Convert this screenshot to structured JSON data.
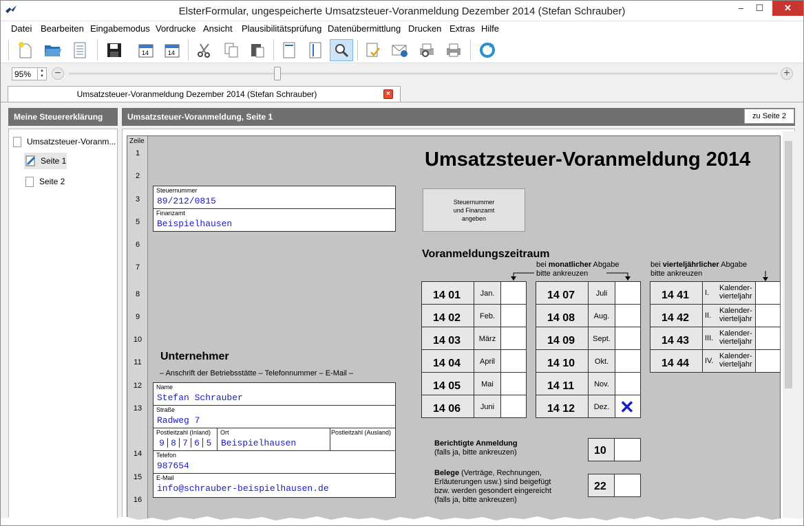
{
  "window": {
    "title": "ElsterFormular, ungespeicherte Umsatzsteuer-Voranmeldung Dezember 2014 (Stefan Schrauber)"
  },
  "menu": [
    "Datei",
    "Bearbeiten",
    "Eingabemodus",
    "Vordrucke",
    "Ansicht",
    "Plausibilitätsprüfung",
    "Datenübermittlung",
    "Drucken",
    "Extras",
    "Hilfe"
  ],
  "toolbar": {
    "icons": [
      "new-document-icon",
      "open-folder-icon",
      "form-list-icon",
      "save-icon",
      "calendar-prev-icon",
      "calendar-next-icon",
      "cut-icon",
      "copy-icon",
      "paste-icon",
      "fit-width-icon",
      "fit-height-icon",
      "search-icon",
      "check-icon",
      "send-mail-icon",
      "print-preview-icon",
      "print-icon",
      "refresh-icon"
    ]
  },
  "zoom": {
    "value": "95%",
    "minus": "−",
    "plus": "+",
    "level_percent": 29
  },
  "tab": {
    "label": "Umsatzsteuer-Voranmeldung Dezember 2014 (Stefan Schrauber)",
    "close": "×"
  },
  "sidebar": {
    "header": "Meine Steuererklärung",
    "root": "Umsatzsteuer-Voranm...",
    "items": [
      "Seite 1",
      "Seite 2"
    ]
  },
  "main": {
    "header": "Umsatzsteuer-Voranmeldung, Seite 1",
    "next_button": "zu Seite 2"
  },
  "form": {
    "zeile_label": "Zeile",
    "rows": [
      "1",
      "2",
      "3",
      "5",
      "6",
      "7",
      "8",
      "9",
      "10",
      "11",
      "12",
      "13",
      "14",
      "15",
      "16"
    ],
    "title": "Umsatzsteuer-Voranmeldung 2014",
    "steuernummer": {
      "label": "Steuernummer",
      "value": "89/212/0815"
    },
    "finanzamt": {
      "label": "Finanzamt",
      "value": "Beispielhausen"
    },
    "angeben_button": "Steuernummer\nund Finanzamt\nangeben",
    "zeitraum_title": "Voranmeldungszeitraum",
    "monatlich_note": {
      "pre": "bei ",
      "bold": "monatlicher",
      "post": " Abgabe",
      "line2": "bitte ankreuzen"
    },
    "quartal_note": {
      "pre": "bei ",
      "bold": "vierteljährlicher",
      "post": " Abgabe",
      "line2": "bitte ankreuzen"
    },
    "months_left": [
      {
        "code": "14 01",
        "name": "Jan."
      },
      {
        "code": "14 02",
        "name": "Feb."
      },
      {
        "code": "14 03",
        "name": "März"
      },
      {
        "code": "14 04",
        "name": "April"
      },
      {
        "code": "14 05",
        "name": "Mai"
      },
      {
        "code": "14 06",
        "name": "Juni"
      }
    ],
    "months_right": [
      {
        "code": "14 07",
        "name": "Juli"
      },
      {
        "code": "14 08",
        "name": "Aug."
      },
      {
        "code": "14 09",
        "name": "Sept."
      },
      {
        "code": "14 10",
        "name": "Okt."
      },
      {
        "code": "14 11",
        "name": "Nov."
      },
      {
        "code": "14 12",
        "name": "Dez.",
        "checked": "✕"
      }
    ],
    "quarters": [
      {
        "code": "14 41",
        "roman": "I.",
        "text": "Kalender-\nvierteljahr"
      },
      {
        "code": "14 42",
        "roman": "II.",
        "text": "Kalender-\nvierteljahr"
      },
      {
        "code": "14 43",
        "roman": "III.",
        "text": "Kalender-\nvierteljahr"
      },
      {
        "code": "14 44",
        "roman": "IV.",
        "text": "Kalender-\nvierteljahr"
      }
    ],
    "unternehmer_title": "Unternehmer",
    "unternehmer_sub": "– Anschrift der Betriebsstätte – Telefonnummer – E-Mail –",
    "name": {
      "label": "Name",
      "value": "Stefan Schrauber"
    },
    "strasse": {
      "label": "Straße",
      "value": "Radweg 7"
    },
    "plz": {
      "label": "Postleitzahl (Inland)",
      "digits": [
        "9",
        "8",
        "7",
        "6",
        "5"
      ]
    },
    "ort": {
      "label": "Ort",
      "value": "Beispielhausen"
    },
    "plz_ausland": {
      "label": "Postleitzahl (Ausland)"
    },
    "telefon": {
      "label": "Telefon",
      "value": "987654"
    },
    "email": {
      "label": "E-Mail",
      "value": "info@schrauber-beispielhausen.de"
    },
    "berichtigt": {
      "bold": "Berichtigte Anmeldung",
      "sub": "(falls ja, bitte ankreuzen)",
      "code": "10"
    },
    "belege": {
      "bold": "Belege",
      "text": " (Verträge, Rechnungen,",
      "line2": "Erläuterungen usw.) sind beigefügt",
      "line3": "bzw. werden gesondert eingereicht",
      "line4": "(falls ja, bitte ankreuzen)",
      "code": "22"
    }
  }
}
